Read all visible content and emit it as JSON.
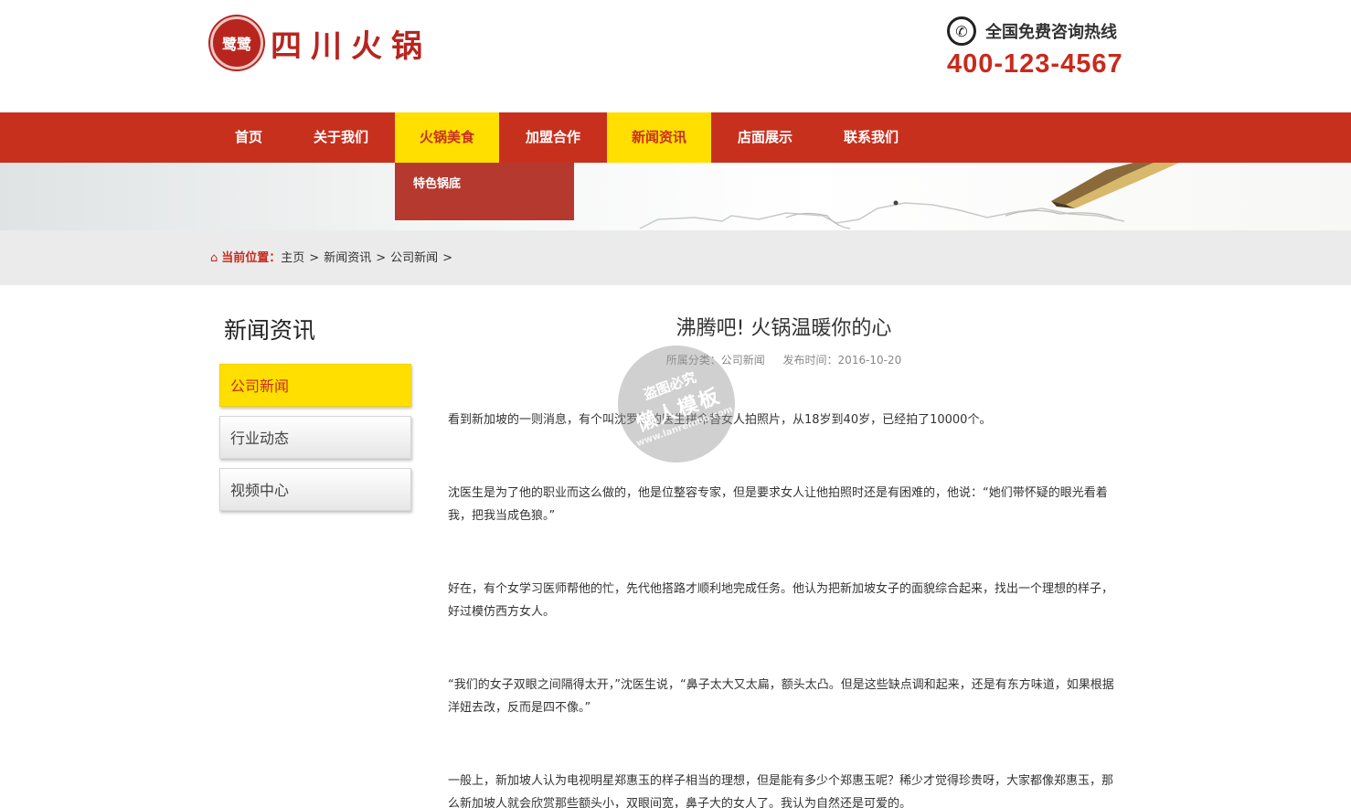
{
  "header": {
    "logo_seal_text": "鹭鹭",
    "logo_text": "四川火锅",
    "hotline_label": "全国免费咨询热线",
    "hotline_number": "400-123-4567"
  },
  "nav": {
    "items": [
      {
        "label": "首页"
      },
      {
        "label": "关于我们"
      },
      {
        "label": "火锅美食"
      },
      {
        "label": "加盟合作"
      },
      {
        "label": "新闻资讯"
      },
      {
        "label": "店面展示"
      },
      {
        "label": "联系我们"
      }
    ],
    "dropdown": {
      "item": "特色锅底"
    }
  },
  "breadcrumb": {
    "label": "当前位置：",
    "items": [
      "主页",
      "新闻资讯",
      "公司新闻"
    ],
    "sep": ">"
  },
  "sidebar": {
    "title": "新闻资讯",
    "items": [
      {
        "label": "公司新闻"
      },
      {
        "label": "行业动态"
      },
      {
        "label": "视频中心"
      }
    ]
  },
  "article": {
    "title": "沸腾吧! 火锅温暖你的心",
    "category": "所属分类：公司新闻",
    "date": "发布时间：2016-10-20",
    "paragraphs": [
      "看到新加坡的一则消息，有个叫沈罗连的医生拼命替女人拍照片，从18岁到40岁，已经拍了10000个。",
      "沈医生是为了他的职业而这么做的，他是位整容专家，但是要求女人让他拍照时还是有困难的，他说：“她们带怀疑的眼光看着我，把我当成色狼。”",
      "好在，有个女学习医师帮他的忙，先代他搭路才顺利地完成任务。他认为把新加坡女子的面貌综合起来，找出一个理想的样子，好过模仿西方女人。",
      "“我们的女子双眼之间隔得太开，”沈医生说，“鼻子太大又太扁，额头太凸。但是这些缺点调和起来，还是有东方味道，如果根据洋妞去改，反而是四不像。”",
      "一般上，新加坡人认为电视明星郑惠玉的样子相当的理想，但是能有多少个郑惠玉呢？稀少才觉得珍贵呀，大家都像郑惠玉，那么新加坡人就会欣赏那些额头小，双眼间宽，鼻子大的女人了。我认为自然还是可爱的。"
    ]
  },
  "watermark": {
    "line1": "盗图必究",
    "line2": "懒人模板",
    "line3": "www.lanrenmb.com"
  }
}
